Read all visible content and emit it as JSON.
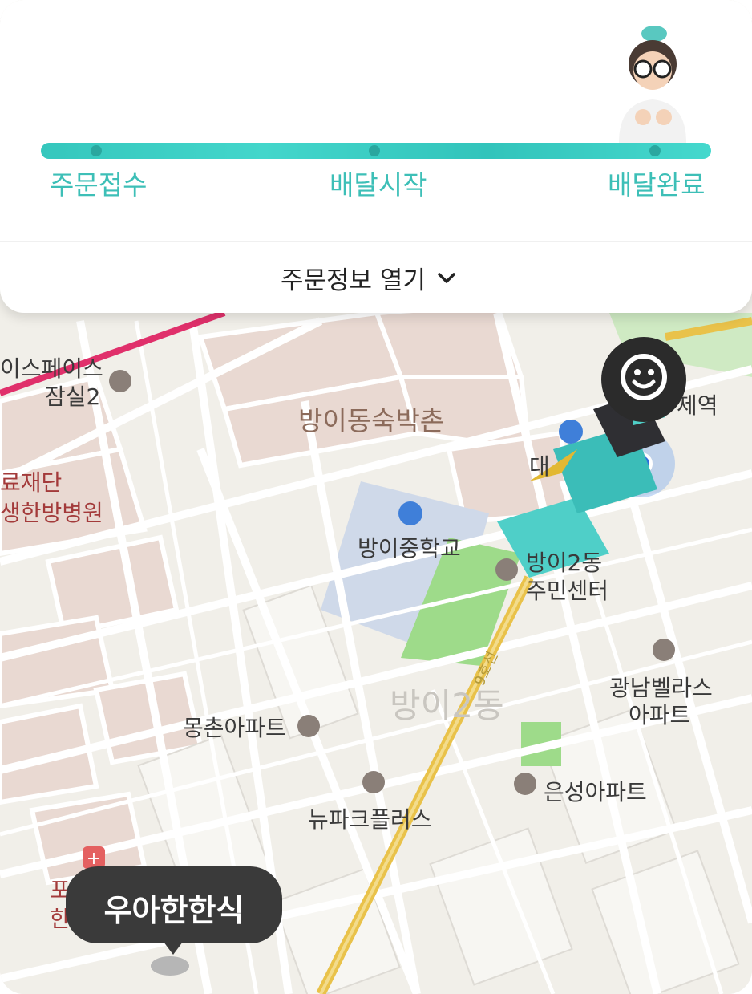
{
  "progress": {
    "steps": [
      "주문접수",
      "배달시작",
      "배달완료"
    ],
    "accent_color": "#3dbfb7"
  },
  "order_info_toggle": {
    "label": "주문정보 열기",
    "icon": "chevron-down-icon"
  },
  "map": {
    "labels": {
      "space": "이스페이스",
      "jamsil": "잠실2",
      "motel_village": "방이동숙박촌",
      "station": "제역",
      "foundation": "료재단",
      "hospital": "생한방병원",
      "middle_school": "방이중학교",
      "community_center_1": "방이2동",
      "community_center_2": "주민센터",
      "gwangnam_1": "광남벨라스",
      "gwangnam_2": "아파트",
      "district": "방이2동",
      "mongchon": "몽촌아파트",
      "eunseong": "은성아파트",
      "newpark": "뉴파크플러스",
      "po": "포",
      "han": "한",
      "daeshort": "대",
      "road_name": "9호선"
    },
    "restaurant_tooltip": "우아한한식"
  }
}
